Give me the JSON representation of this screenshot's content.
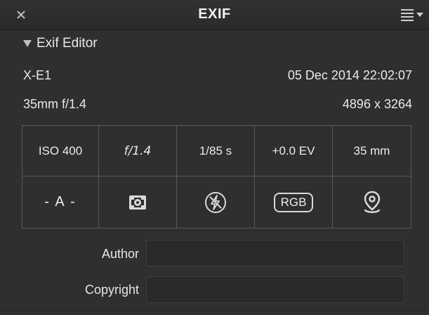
{
  "window": {
    "title": "EXIF"
  },
  "section": {
    "title": "Exif Editor"
  },
  "info": {
    "camera": "X-E1",
    "datetime": "05 Dec 2014 22:02:07",
    "lens": "35mm f/1.4",
    "dimensions": "4896 x 3264"
  },
  "exposure": {
    "iso": "ISO 400",
    "aperture": "f/1.4",
    "shutter": "1/85 s",
    "ev": "+0.0 EV",
    "focal": "35 mm"
  },
  "modes": {
    "exposure_mode": "- A -",
    "metering_icon": "metering-icon",
    "flash_icon": "flash-off-icon",
    "color_space": "RGB",
    "location_icon": "location-pin-icon"
  },
  "fields": {
    "author_label": "Author",
    "author_value": "",
    "copyright_label": "Copyright",
    "copyright_value": ""
  },
  "colors": {
    "background": "#2f2f2f",
    "grid_line": "#585858",
    "text": "#e8e8e8"
  }
}
